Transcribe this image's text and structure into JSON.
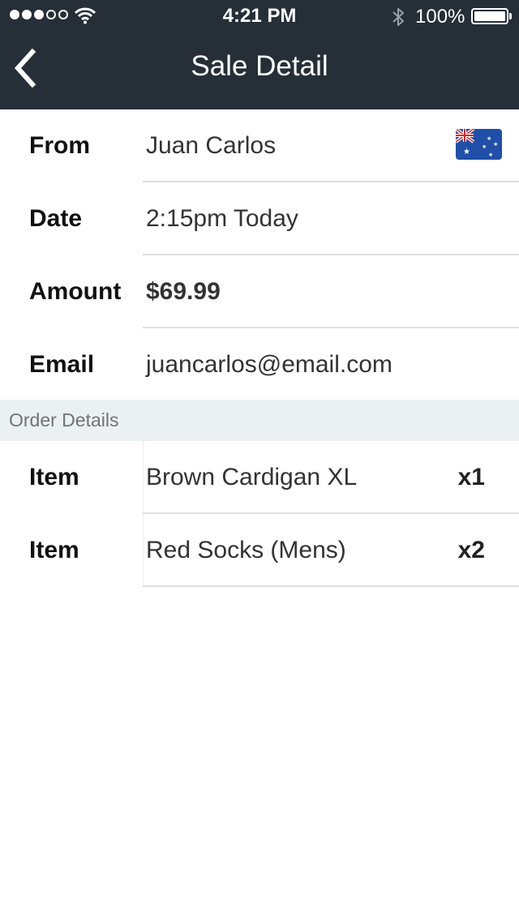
{
  "status_bar": {
    "time": "4:21 PM",
    "battery": "100%",
    "signal_bars": 3,
    "signal_total": 5
  },
  "nav": {
    "title": "Sale Detail",
    "back_icon": "chevron-left-icon"
  },
  "details": {
    "from_label": "From",
    "from_value": "Juan Carlos",
    "date_label": "Date",
    "date_value": "2:15pm Today",
    "amount_label": "Amount",
    "amount_value": "$69.99",
    "email_label": "Email",
    "email_value": "juancarlos@email.com",
    "flag_icon": "australia-flag-icon"
  },
  "order": {
    "section_title": "Order Details",
    "items": [
      {
        "label": "Item",
        "name": "Brown Cardigan XL",
        "qty": "x1"
      },
      {
        "label": "Item",
        "name": "Red Socks (Mens)",
        "qty": "x2"
      }
    ]
  },
  "colors": {
    "header_bg": "#262e38",
    "section_bg": "#ebf0f2",
    "divider": "#dddfe1"
  }
}
